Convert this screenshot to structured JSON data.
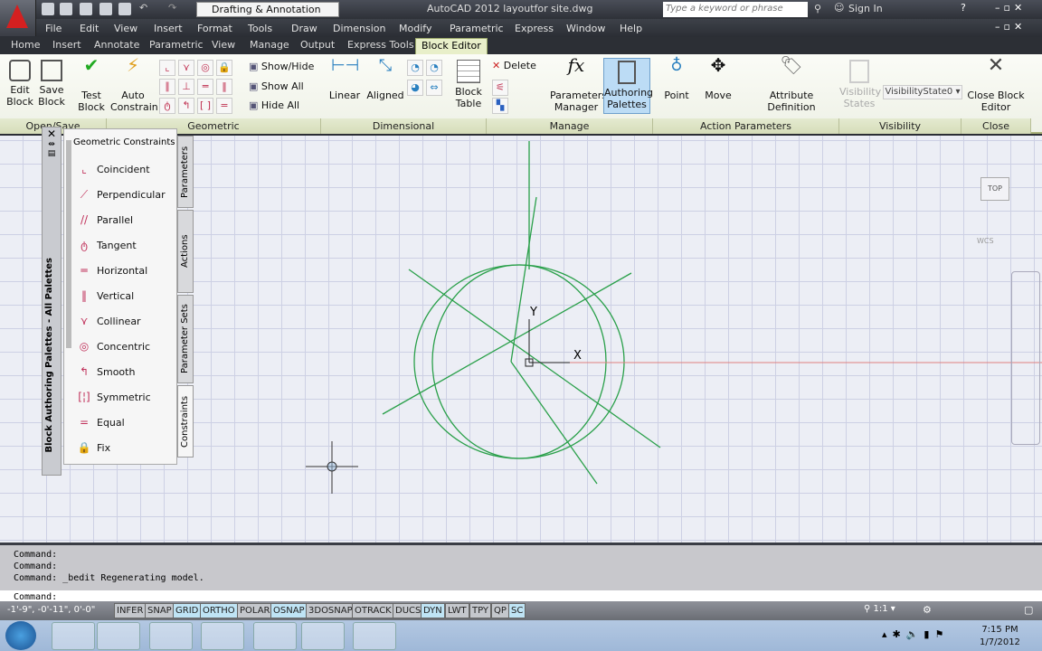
{
  "titlebar": {
    "workspace": "Drafting & Annotation",
    "app_title": "AutoCAD 2012   layoutfor site.dwg",
    "search_placeholder": "Type a keyword or phrase",
    "sign_in": "Sign In"
  },
  "menu": [
    "File",
    "Edit",
    "View",
    "Insert",
    "Format",
    "Tools",
    "Draw",
    "Dimension",
    "Modify",
    "Parametric",
    "Express",
    "Window",
    "Help"
  ],
  "ribbon_tabs": [
    "Home",
    "Insert",
    "Annotate",
    "Parametric",
    "View",
    "Manage",
    "Output",
    "Express Tools",
    "Block Editor"
  ],
  "ribbon": {
    "edit_block": "Edit Block",
    "save_block": "Save Block",
    "test_block": "Test Block",
    "auto_constrain": "Auto Constrain",
    "show_hide": "Show/Hide",
    "show_all": "Show All",
    "hide_all": "Hide All",
    "linear": "Linear",
    "aligned": "Aligned",
    "block_table": "Block Table",
    "delete": "Delete",
    "parameters_manager": "Parameters Manager",
    "authoring_palettes": "Authoring Palettes",
    "point": "Point",
    "move": "Move",
    "attribute_definition": "Attribute Definition",
    "visibility_states": "Visibility States",
    "visibility_state_value": "VisibilityState0",
    "close_block_editor": "Close Block Editor",
    "panels": [
      "Open/Save",
      "Geometric",
      "Dimensional",
      "Manage",
      "Action Parameters",
      "Visibility",
      "Close"
    ]
  },
  "palette": {
    "title": "Block Authoring Palettes - All Palettes",
    "heading": "Geometric Constraints",
    "items": [
      "Coincident",
      "Perpendicular",
      "Parallel",
      "Tangent",
      "Horizontal",
      "Vertical",
      "Collinear",
      "Concentric",
      "Smooth",
      "Symmetric",
      "Equal",
      "Fix"
    ],
    "tabs": [
      "Parameters",
      "Actions",
      "Parameter Sets",
      "Constraints"
    ]
  },
  "viewcube": {
    "top": "TOP",
    "wcs": "WCS"
  },
  "ucs": {
    "x": "X",
    "y": "Y"
  },
  "command": {
    "history": [
      "Command:",
      "Command:",
      "Command: _bedit Regenerating model."
    ],
    "prompt": "Command:"
  },
  "status": {
    "coords": "-1'-9\", -0'-11\", 0'-0\"",
    "toggles": [
      "INFER",
      "SNAP",
      "GRID",
      "ORTHO",
      "POLAR",
      "OSNAP",
      "3DOSNAP",
      "OTRACK",
      "DUCS",
      "DYN",
      "LWT",
      "TPY",
      "QP",
      "SC"
    ],
    "active": [
      "GRID",
      "ORTHO",
      "OSNAP",
      "DYN",
      "SC"
    ],
    "scale": "1:1"
  },
  "taskbar": {
    "time": "7:15 PM",
    "date": "1/7/2012"
  },
  "colors": {
    "geometry": "#2aa04a",
    "ribbon_accent": "#e8efc9"
  }
}
